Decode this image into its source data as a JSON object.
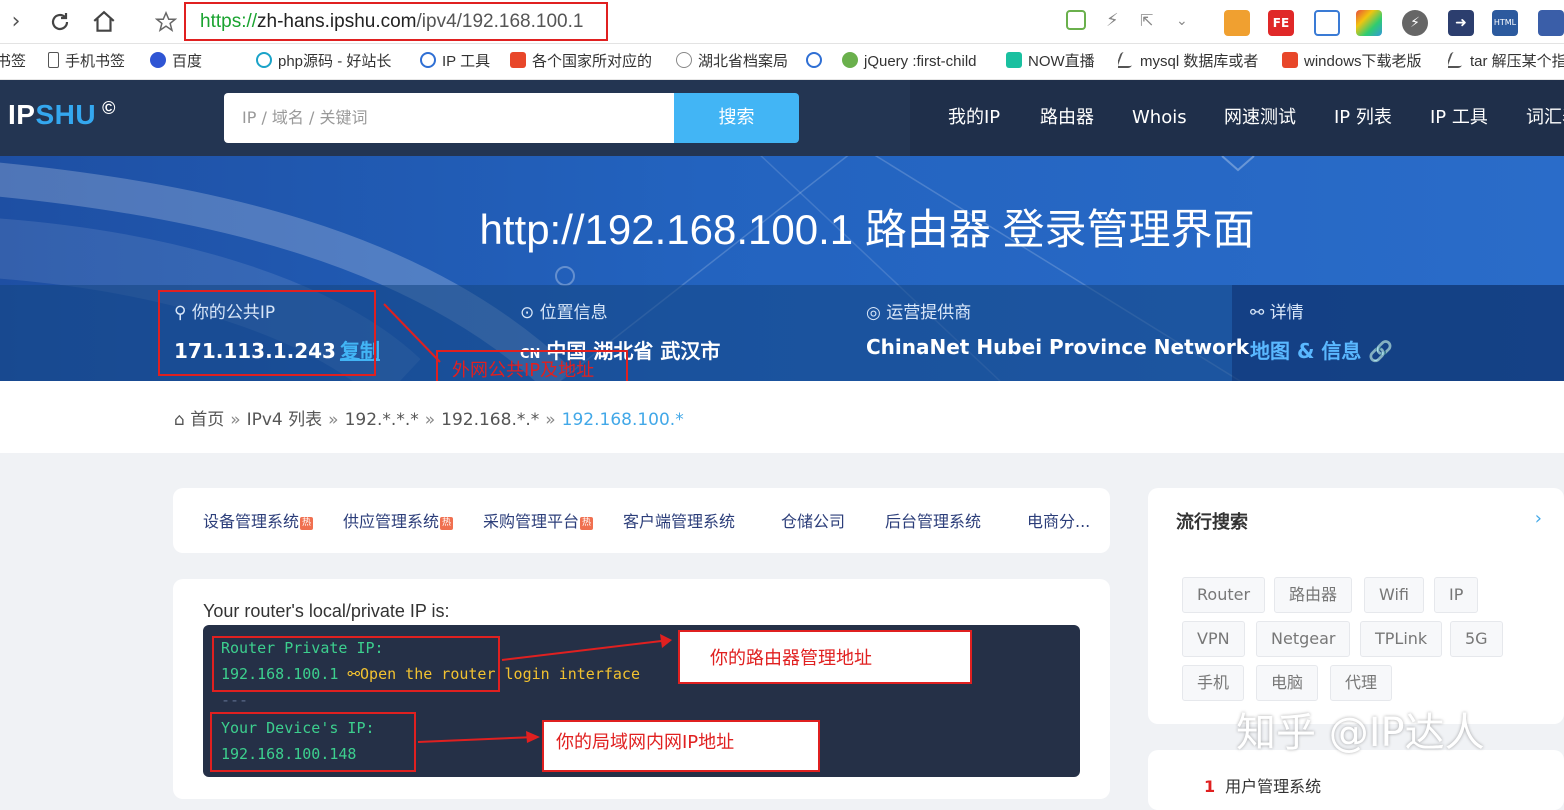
{
  "browser": {
    "url_proto": "https://",
    "url_host": "zh-hans.ipshu.com",
    "url_path": "/ipv4/192.168.100.1",
    "bookmarks": [
      {
        "label": "书签",
        "color": "#888"
      },
      {
        "label": "手机书签",
        "color": "#555"
      },
      {
        "label": "百度",
        "color": "#2f55d4"
      },
      {
        "label": "php源码 - 好站长",
        "color": "#1aa3c8"
      },
      {
        "label": "IP 工具",
        "color": "#2f6fd4"
      },
      {
        "label": "各个国家所对应的",
        "color": "#e8472a"
      },
      {
        "label": "湖北省档案局",
        "color": "#888"
      },
      {
        "label": "",
        "color": "#2f6fd4"
      },
      {
        "label": "jQuery :first-child",
        "color": "#6ab04c"
      },
      {
        "label": "NOW直播",
        "color": "#1ac0a0"
      },
      {
        "label": "mysql 数据库或者",
        "color": "#555"
      },
      {
        "label": "windows下载老版",
        "color": "#e8472a"
      },
      {
        "label": "tar 解压某个指",
        "color": "#555"
      }
    ]
  },
  "header": {
    "logo_ip": "IP",
    "logo_shu": "SHU",
    "logo_mark": "©",
    "search_placeholder": "IP / 域名 / 关键词",
    "search_button": "搜索",
    "nav": [
      "我的IP",
      "路由器",
      "Whois",
      "网速测试",
      "IP 列表",
      "IP 工具",
      "词汇表"
    ]
  },
  "hero": {
    "title": "http://192.168.100.1 路由器 登录管理界面",
    "public_ip_label": "你的公共IP",
    "public_ip_value": "171.113.1.243",
    "copy_label": "复制",
    "location_label": "位置信息",
    "location_cc": "CN",
    "location_value": "中国 湖北省 武汉市",
    "isp_label": "运营提供商",
    "isp_value": "ChinaNet Hubei Province Network",
    "detail_label": "详情",
    "detail_value": "地图 & 信息"
  },
  "annotations": {
    "public_ip_note": "外网公共IP及地址",
    "router_note": "你的路由器管理地址",
    "device_note": "你的局域网内网IP地址"
  },
  "breadcrumb": {
    "home": "首页",
    "items": [
      "IPv4 列表",
      "192.*.*.*",
      "192.168.*.*"
    ],
    "current": "192.168.100.*"
  },
  "tags": [
    {
      "label": "设备管理系统",
      "hot": true
    },
    {
      "label": "供应管理系统",
      "hot": true
    },
    {
      "label": "采购管理平台",
      "hot": true
    },
    {
      "label": "客户端管理系统",
      "hot": false
    },
    {
      "label": "仓储公司",
      "hot": false
    },
    {
      "label": "后台管理系统",
      "hot": false
    },
    {
      "label": "电商分...",
      "hot": false
    }
  ],
  "router": {
    "intro": "Your router's local/private IP is:",
    "router_label": "Router Private IP:",
    "router_ip": "192.168.100.1",
    "router_link": "Open the router login interface",
    "separator": "---",
    "device_label": "Your Device's IP:",
    "device_ip": "192.168.100.148"
  },
  "sidebar": {
    "title": "流行搜索",
    "arrow": "›",
    "popular": [
      "Router",
      "路由器",
      "Wifi",
      "IP",
      "VPN",
      "Netgear",
      "TPLink",
      "5G",
      "手机",
      "电脑",
      "代理"
    ],
    "list_first_num": "1",
    "list_first": "用户管理系统"
  },
  "watermark": "知乎 @IP达人"
}
